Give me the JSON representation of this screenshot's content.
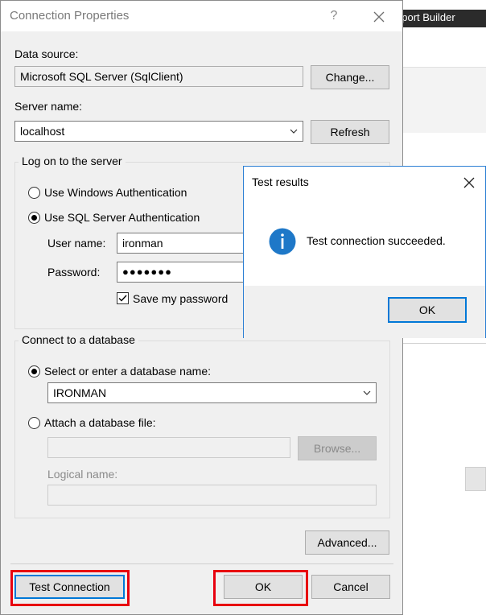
{
  "background_app": {
    "title_fragment": "eport Builder"
  },
  "dialog": {
    "title": "Connection Properties",
    "help_glyph": "?",
    "data_source": {
      "label": "Data source:",
      "value": "Microsoft SQL Server (SqlClient)",
      "change_button": "Change..."
    },
    "server": {
      "label": "Server name:",
      "value": "localhost",
      "refresh_button": "Refresh"
    },
    "logon": {
      "legend": "Log on to the server",
      "windows_auth": "Use Windows Authentication",
      "sql_auth": "Use SQL Server Authentication",
      "selected": "sql_auth",
      "username_label": "User name:",
      "username_value": "ironman",
      "password_label": "Password:",
      "password_value": "●●●●●●●",
      "save_password": "Save my password",
      "save_password_checked": true
    },
    "database": {
      "legend": "Connect to a database",
      "select_option": "Select or enter a database name:",
      "select_value": "IRONMAN",
      "attach_option": "Attach a database file:",
      "attach_value": "",
      "browse_button": "Browse...",
      "logical_label": "Logical name:",
      "logical_value": ""
    },
    "advanced_button": "Advanced...",
    "test_connection_button": "Test Connection",
    "ok_button": "OK",
    "cancel_button": "Cancel"
  },
  "test_results": {
    "title": "Test results",
    "message": "Test connection succeeded.",
    "icon": "info-icon",
    "ok_button": "OK"
  },
  "colors": {
    "accent": "#0078d7",
    "highlight": "#e8000f",
    "info": "#1e78c8"
  }
}
